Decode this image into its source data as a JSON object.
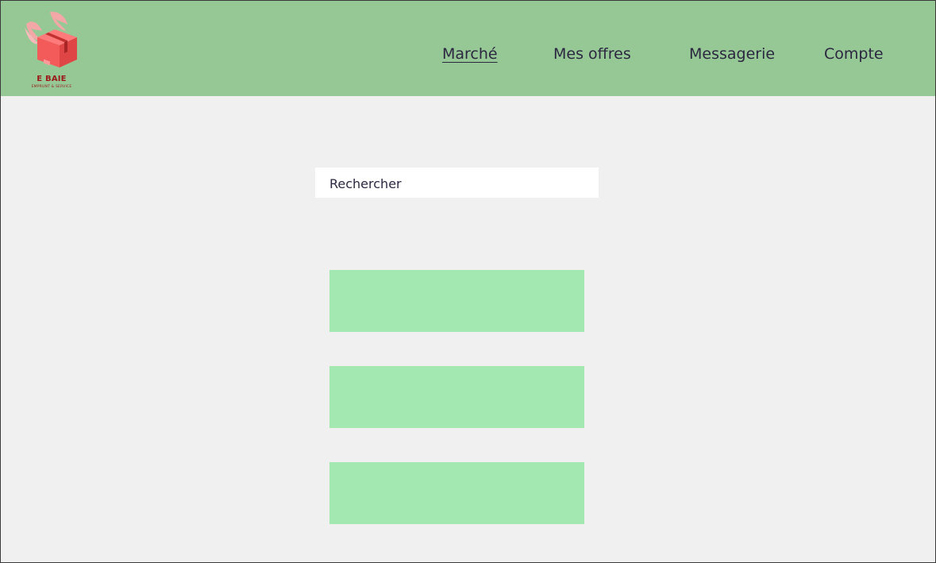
{
  "brand": {
    "name": "E BAIE",
    "tagline": "EMPRUNT & SERVICE",
    "logo_icon": "winged-box-icon",
    "colors": {
      "box": "#f35a5a",
      "wings": "#f4a7a7",
      "text": "#9a1a1a"
    }
  },
  "nav": {
    "items": [
      {
        "label": "Marché",
        "active": true
      },
      {
        "label": "Mes offres",
        "active": false
      },
      {
        "label": "Messagerie",
        "active": false
      },
      {
        "label": "Compte",
        "active": false
      }
    ]
  },
  "search": {
    "placeholder": "Rechercher",
    "value": ""
  },
  "listings": {
    "count_shown": 3
  },
  "colors": {
    "header_bg": "#96c896",
    "page_bg": "#f0f0f0",
    "card_bg": "#a2e8b0",
    "text": "#2c2740"
  }
}
